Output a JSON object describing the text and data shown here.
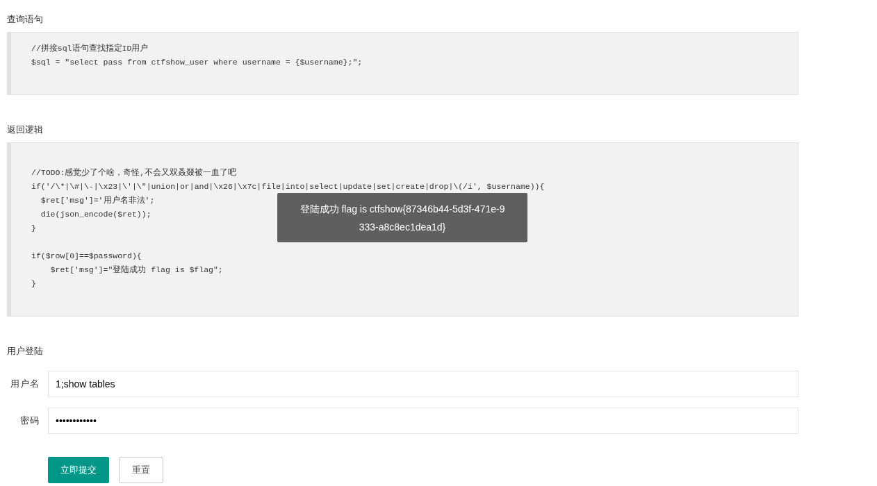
{
  "sections": [
    {
      "kind": "code",
      "title": "查询语句",
      "groups": [
        [
          "//拼接sql语句查找指定ID用户",
          "$sql = \"select pass from ctfshow_user where username = {$username};\";"
        ]
      ]
    },
    {
      "kind": "code",
      "title": "返回逻辑",
      "groups": [
        [
          "//TODO:感觉少了个啥，奇怪,不会又双叒叕被一血了吧",
          "if('/\\*|\\#|\\-|\\x23|\\'|\\\"|union|or|and|\\x26|\\x7c|file|into|select|update|set|create|drop|\\(/i', $username)){",
          "  $ret['msg']='用户名非法';",
          "  die(json_encode($ret));",
          "}"
        ],
        [
          "if($row[0]==$password){",
          "    $ret['msg']=\"登陆成功 flag is $flag\";",
          "}"
        ]
      ]
    },
    {
      "kind": "form",
      "title": "用户登陆",
      "fields": [
        {
          "label": "用户名",
          "value": "1;show tables"
        },
        {
          "label": "密码",
          "value": "••••••••••••"
        }
      ],
      "buttons": [
        {
          "label": "立即提交",
          "kind": "primary"
        },
        {
          "label": "重置",
          "kind": "secondary"
        }
      ]
    }
  ],
  "toast": {
    "message": "登陆成功 flag is ctfshow{87346b44-5d3f-471e-9333-a8c8ec1dea1d}"
  }
}
